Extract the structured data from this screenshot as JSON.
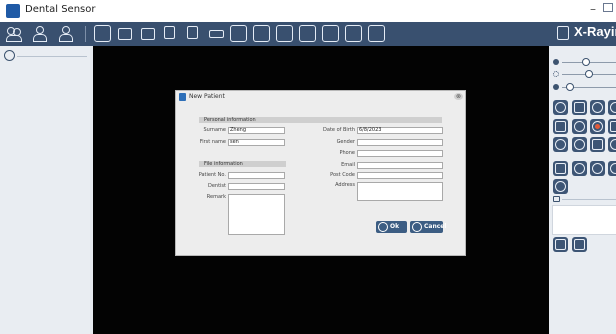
{
  "app": {
    "title": "Dental Sensor",
    "brand": "X-Raying"
  },
  "window_controls": [
    {
      "name": "minimize",
      "glyph": "–"
    },
    {
      "name": "maximize",
      "glyph": ""
    }
  ],
  "toolbar": {
    "left_icons": [
      "patients-icon",
      "add-patient-icon",
      "patient-info-icon"
    ],
    "tool_icons": [
      "sensor-icon",
      "import-icon",
      "export-icon",
      "copy-image-icon",
      "paste-image-icon",
      "print-icon",
      "window-icon",
      "layout-icon",
      "image-list-icon",
      "capture-icon",
      "browse-icon",
      "settings-icon",
      "help-icon"
    ],
    "brand_icon": "scanner-icon"
  },
  "left_panel": {
    "user_icon": "user-icon"
  },
  "right_panel": {
    "sliders": [
      {
        "icon": "brightness-icon",
        "value": 0.55
      },
      {
        "icon": "contrast-icon",
        "value": 0.6
      },
      {
        "icon": "gamma-icon",
        "value": 0.1
      }
    ],
    "tool_rows": [
      [
        "rotate-icon",
        "sharpen-icon",
        "magnify-icon",
        "flip-icon"
      ],
      [
        "measure-icon",
        "invert-icon",
        "colorize-icon",
        "annotate-icon"
      ],
      [
        "print-icon",
        "filter-icon",
        "edit-icon",
        "zoom-icon"
      ],
      [
        "tooth-icon",
        "tooth-map-icon",
        "tooth-detail-icon",
        "tooth-extra-icon"
      ],
      [
        "reset-icon"
      ]
    ],
    "note_icon": "note-icon",
    "bottom_icons": [
      "compare-icon",
      "compare-alt-icon"
    ]
  },
  "dialog": {
    "title": "New Patient",
    "close_glyph": "⊗",
    "personal_section": "Personal information",
    "file_section": "File information",
    "fields": {
      "surname": {
        "label": "Surname",
        "value": "Zheng"
      },
      "first_name": {
        "label": "First name",
        "value": "sen"
      },
      "date_of_birth": {
        "label": "Date of Birth",
        "value": "6/8/2023"
      },
      "gender": {
        "label": "Gender",
        "value": ""
      },
      "phone": {
        "label": "Phone",
        "value": ""
      },
      "email": {
        "label": "Email",
        "value": ""
      },
      "post_code": {
        "label": "Post Code",
        "value": ""
      },
      "address": {
        "label": "Address",
        "value": ""
      },
      "patient_no": {
        "label": "Patient No.",
        "value": ""
      },
      "dentist": {
        "label": "Dentist",
        "value": ""
      },
      "remark": {
        "label": "Remark",
        "value": ""
      }
    },
    "ok_label": "Ok",
    "cancel_label": "Cancel"
  },
  "colors": {
    "toolbar": "#39506f",
    "viewer": "#030303",
    "button": "#3c5d83",
    "panel": "#e9edf2"
  }
}
